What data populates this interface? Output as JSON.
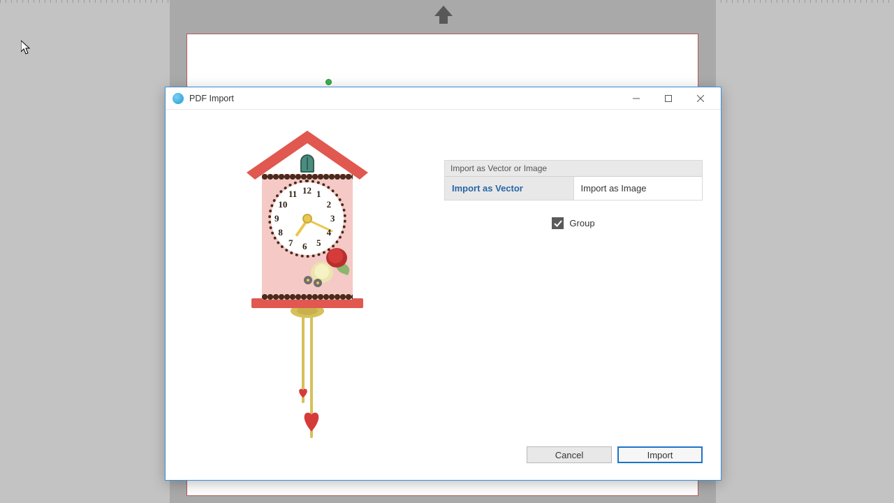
{
  "dialog": {
    "title": "PDF Import",
    "section_label": "Import as Vector or Image",
    "tab_vector": "Import as Vector",
    "tab_image": "Import as Image",
    "group_label": "Group",
    "group_checked": true,
    "cancel_label": "Cancel",
    "import_label": "Import"
  },
  "clock": {
    "numerals": [
      "12",
      "1",
      "2",
      "3",
      "4",
      "5",
      "6",
      "7",
      "8",
      "9",
      "10",
      "11"
    ]
  }
}
